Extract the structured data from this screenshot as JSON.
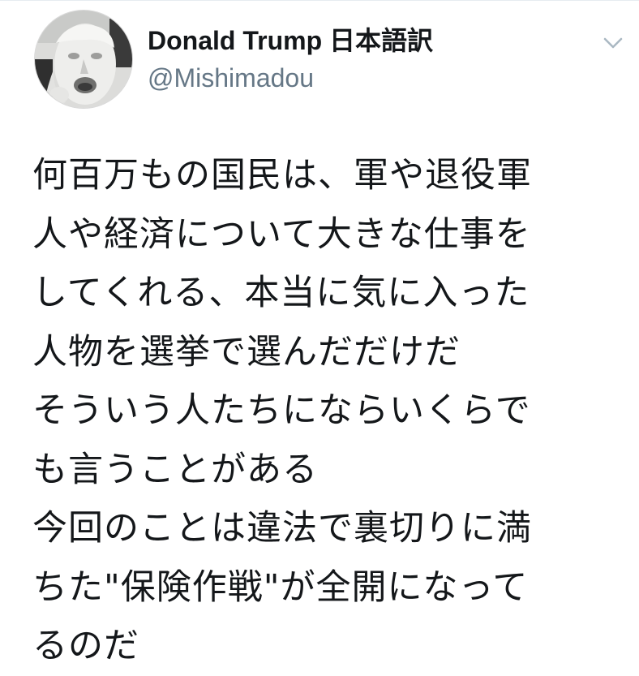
{
  "tweet": {
    "display_name": "Donald Trump 日本語訳",
    "username": "@Mishimadou",
    "menu_icon": "chevron-down-icon",
    "avatar_icon": "profile-avatar",
    "lines": [
      "何百万もの国民は、軍や退役軍",
      "人や経済について大きな仕事を",
      "してくれる、本当に気に入った",
      "人物を選挙で選んだだけだ",
      "そういう人たちにならいくらで",
      "も言うことがある",
      "今回のことは違法で裏切りに満",
      "ちた\"保険作戦\"が全開になって",
      "るのだ"
    ]
  },
  "colors": {
    "text": "#14171a",
    "secondary_text": "#657786",
    "divider": "#e6ecf0",
    "caret": "#aab8c2"
  }
}
